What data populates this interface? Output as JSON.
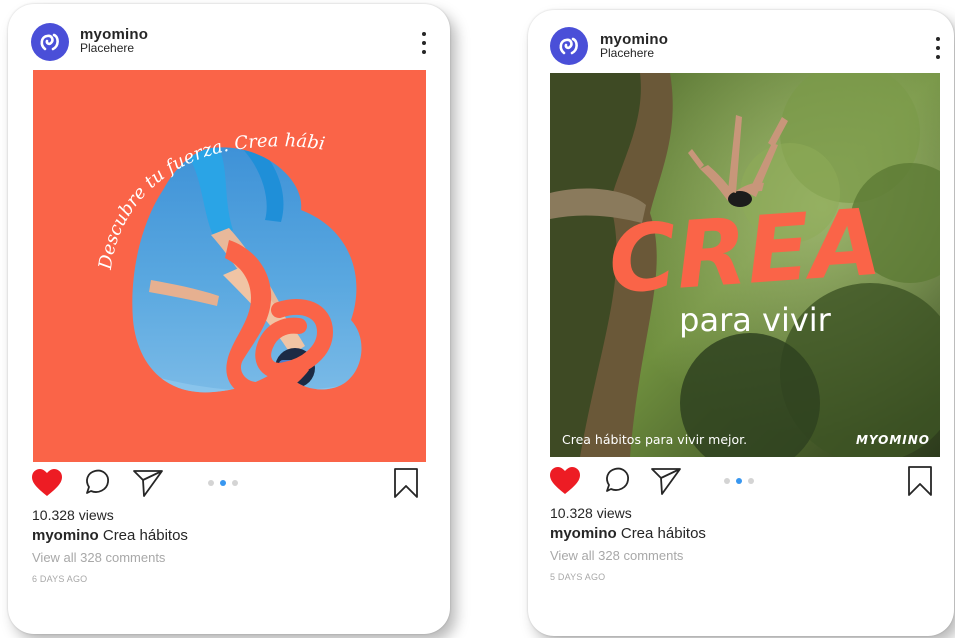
{
  "posts": [
    {
      "username": "myomino",
      "location": "Placehere",
      "image": {
        "curved_text": "Descubre tu fuerza. Crea hábitos"
      },
      "views": "10.328 views",
      "caption_user": "myomino",
      "caption_text": "Crea hábitos",
      "comments_link": "View all 328 comments",
      "time_ago": "6 DAYS AGO",
      "carousel": {
        "count": 3,
        "active_index": 1
      },
      "liked": true
    },
    {
      "username": "myomino",
      "location": "Placehere",
      "image": {
        "headline": "CREA",
        "subheadline": "para vivir",
        "footer_text": "Crea hábitos para vivir mejor.",
        "brand": "MYOMINO"
      },
      "views": "10.328 views",
      "caption_user": "myomino",
      "caption_text": "Crea hábitos",
      "comments_link": "View all 328 comments",
      "time_ago": "5 DAYS AGO",
      "carousel": {
        "count": 3,
        "active_index": 1
      },
      "liked": true
    }
  ],
  "icons": {
    "avatar": "myomino-logo-icon",
    "more": "more-options-icon",
    "like": "heart-icon",
    "comment": "comment-icon",
    "share": "send-icon",
    "save": "bookmark-icon"
  },
  "colors": {
    "brand_coral": "#fa6448",
    "avatar_blue": "#4a4fd8",
    "like_red": "#ed1c24",
    "carousel_active": "#3897f0"
  }
}
